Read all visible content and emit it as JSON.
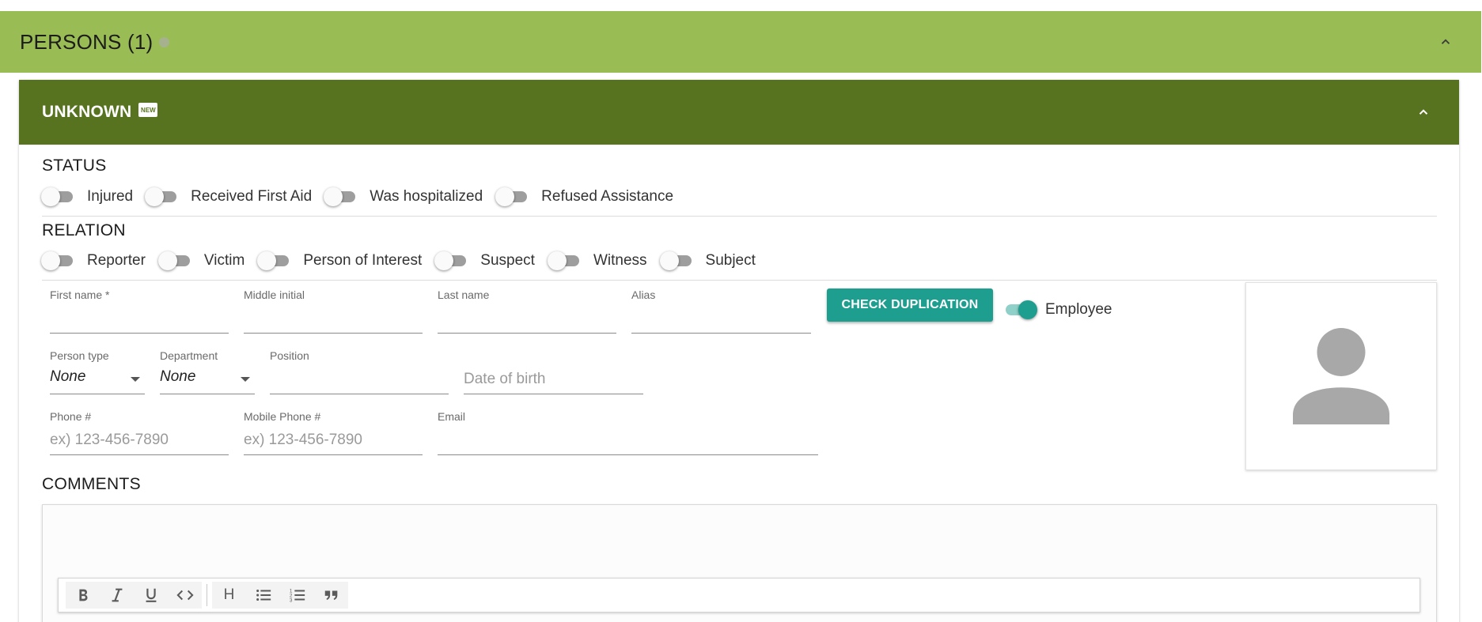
{
  "persons": {
    "title": "PERSONS (1)"
  },
  "person": {
    "title": "UNKNOWN",
    "badge": "NEW"
  },
  "status": {
    "heading": "STATUS",
    "toggles": [
      {
        "label": "Injured",
        "on": false
      },
      {
        "label": "Received First Aid",
        "on": false
      },
      {
        "label": "Was hospitalized",
        "on": false
      },
      {
        "label": "Refused Assistance",
        "on": false
      }
    ]
  },
  "relation": {
    "heading": "RELATION",
    "toggles": [
      {
        "label": "Reporter",
        "on": false
      },
      {
        "label": "Victim",
        "on": false
      },
      {
        "label": "Person of Interest",
        "on": false
      },
      {
        "label": "Suspect",
        "on": false
      },
      {
        "label": "Witness",
        "on": false
      },
      {
        "label": "Subject",
        "on": false
      }
    ]
  },
  "form": {
    "first_name": {
      "label": "First name *",
      "value": ""
    },
    "middle_initial": {
      "label": "Middle initial",
      "value": ""
    },
    "last_name": {
      "label": "Last name",
      "value": ""
    },
    "alias": {
      "label": "Alias",
      "value": ""
    },
    "check_button": "CHECK DUPLICATION",
    "employee": {
      "label": "Employee",
      "on": true
    },
    "person_type": {
      "label": "Person type",
      "value": "None"
    },
    "department": {
      "label": "Department",
      "value": "None"
    },
    "position": {
      "label": "Position",
      "value": ""
    },
    "dob": {
      "placeholder": "Date of birth"
    },
    "phone": {
      "label": "Phone #",
      "placeholder": "ex) 123-456-7890"
    },
    "mobile": {
      "label": "Mobile Phone #",
      "placeholder": "ex) 123-456-7890"
    },
    "email": {
      "label": "Email",
      "value": ""
    }
  },
  "comments": {
    "heading": "COMMENTS",
    "toolbar": [
      "bold-icon",
      "italic-icon",
      "underline-icon",
      "code-icon",
      "heading-icon",
      "bulleted-list-icon",
      "numbered-list-icon",
      "quote-icon"
    ],
    "heading_glyph": "H"
  },
  "colors": {
    "persons_bar": "#99bc55",
    "person_bar": "#58731f",
    "accent": "#1e9e8f"
  }
}
